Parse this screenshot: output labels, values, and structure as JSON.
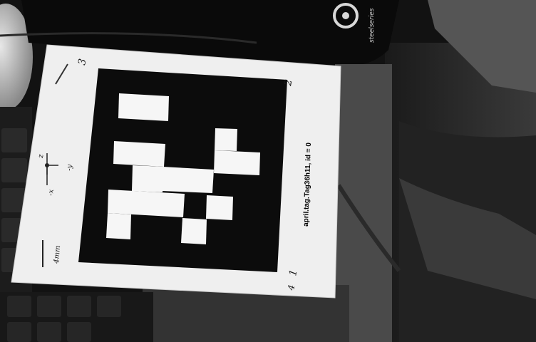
{
  "scene": {
    "brand_logo_text": "steelseries",
    "tag_caption": "april.tag.Tag36h11, id = 0",
    "corner_labels": [
      "3",
      "2",
      "1",
      "4"
    ],
    "axis_labels": [
      "z",
      "-x",
      "-y"
    ],
    "scale_label": "4mm"
  },
  "colors": {
    "paper": "#f0f0f0",
    "tag_black": "#0c0c0c",
    "tag_white": "#f6f6f6",
    "background": "#101010"
  },
  "tag": {
    "family": "Tag36h11",
    "id": 0
  }
}
